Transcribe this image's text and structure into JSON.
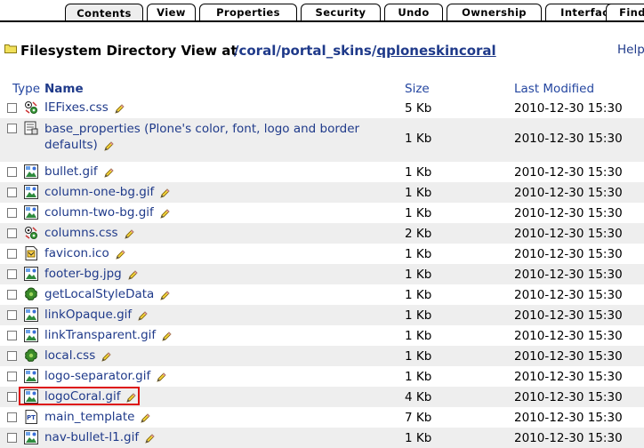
{
  "tabs": [
    "Contents",
    "View",
    "Properties",
    "Security",
    "Undo",
    "Ownership",
    "Interfaces",
    "Find"
  ],
  "active_tab": "Contents",
  "header": {
    "label": "Filesystem Directory View at",
    "path_parts": [
      "/coral",
      "/portal_skins",
      "/",
      "qploneskincoral"
    ],
    "help": "Help!"
  },
  "columns": {
    "type": "Type",
    "name": "Name",
    "size": "Size",
    "modified": "Last Modified"
  },
  "rows": [
    {
      "name": "IEFixes.css",
      "size": "5 Kb",
      "modified": "2010-12-30 15:30",
      "icon": "css-file-icon"
    },
    {
      "name": "base_properties (Plone's color, font, logo and border defaults)",
      "size": "1 Kb",
      "modified": "2010-12-30 15:30",
      "icon": "properties-icon"
    },
    {
      "name": "bullet.gif",
      "size": "1 Kb",
      "modified": "2010-12-30 15:30",
      "icon": "image-icon"
    },
    {
      "name": "column-one-bg.gif",
      "size": "1 Kb",
      "modified": "2010-12-30 15:30",
      "icon": "image-icon"
    },
    {
      "name": "column-two-bg.gif",
      "size": "1 Kb",
      "modified": "2010-12-30 15:30",
      "icon": "image-icon"
    },
    {
      "name": "columns.css",
      "size": "2 Kb",
      "modified": "2010-12-30 15:30",
      "icon": "css-file-icon"
    },
    {
      "name": "favicon.ico",
      "size": "1 Kb",
      "modified": "2010-12-30 15:30",
      "icon": "file-icon"
    },
    {
      "name": "footer-bg.jpg",
      "size": "1 Kb",
      "modified": "2010-12-30 15:30",
      "icon": "image-icon"
    },
    {
      "name": "getLocalStyleData",
      "size": "1 Kb",
      "modified": "2010-12-30 15:30",
      "icon": "script-icon"
    },
    {
      "name": "linkOpaque.gif",
      "size": "1 Kb",
      "modified": "2010-12-30 15:30",
      "icon": "image-icon"
    },
    {
      "name": "linkTransparent.gif",
      "size": "1 Kb",
      "modified": "2010-12-30 15:30",
      "icon": "image-icon"
    },
    {
      "name": "local.css",
      "size": "1 Kb",
      "modified": "2010-12-30 15:30",
      "icon": "script-icon"
    },
    {
      "name": "logo-separator.gif",
      "size": "1 Kb",
      "modified": "2010-12-30 15:30",
      "icon": "image-icon"
    },
    {
      "name": "logoCoral.gif",
      "size": "4 Kb",
      "modified": "2010-12-30 15:30",
      "icon": "image-icon",
      "highlighted": true
    },
    {
      "name": "main_template",
      "size": "7 Kb",
      "modified": "2010-12-30 15:30",
      "icon": "page-template-icon"
    },
    {
      "name": "nav-bullet-l1.gif",
      "size": "1 Kb",
      "modified": "2010-12-30 15:30",
      "icon": "image-icon"
    }
  ],
  "colors": {
    "link": "#1f3a8a",
    "header_text": "#2446a0",
    "row_alt": "#eeeeee",
    "highlight": "#dd1111"
  }
}
